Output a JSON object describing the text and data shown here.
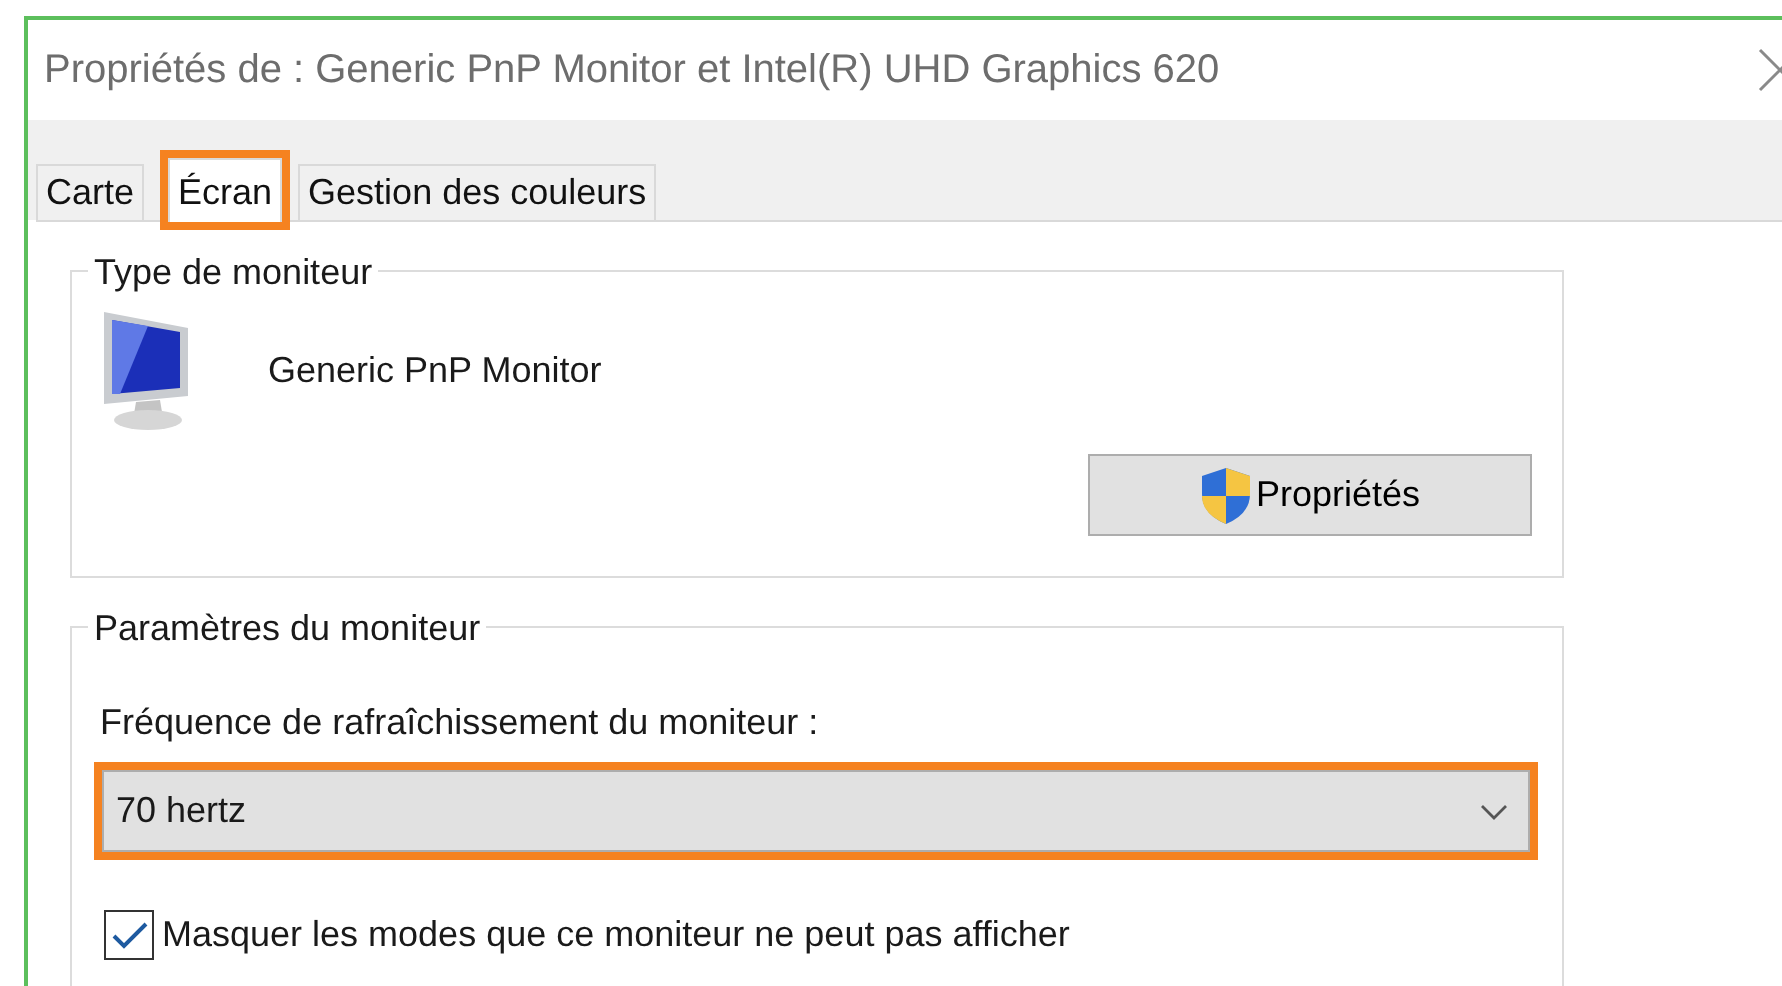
{
  "window": {
    "title": "Propriétés de : Generic PnP Monitor et Intel(R) UHD Graphics 620"
  },
  "tabs": [
    {
      "label": "Carte",
      "selected": false,
      "highlighted": false
    },
    {
      "label": "Écran",
      "selected": true,
      "highlighted": true
    },
    {
      "label": "Gestion des couleurs",
      "selected": false,
      "highlighted": false
    }
  ],
  "monitor_type": {
    "legend": "Type de moniteur",
    "name": "Generic PnP Monitor",
    "button": "Propriétés"
  },
  "monitor_settings": {
    "legend": "Paramètres du moniteur",
    "refresh_label": "Fréquence de rafraîchissement du moniteur :",
    "refresh_rate": {
      "value": "70 hertz",
      "highlighted": true
    },
    "hide_modes": {
      "label": "Masquer les modes que ce moniteur ne peut pas afficher",
      "checked": true
    }
  }
}
